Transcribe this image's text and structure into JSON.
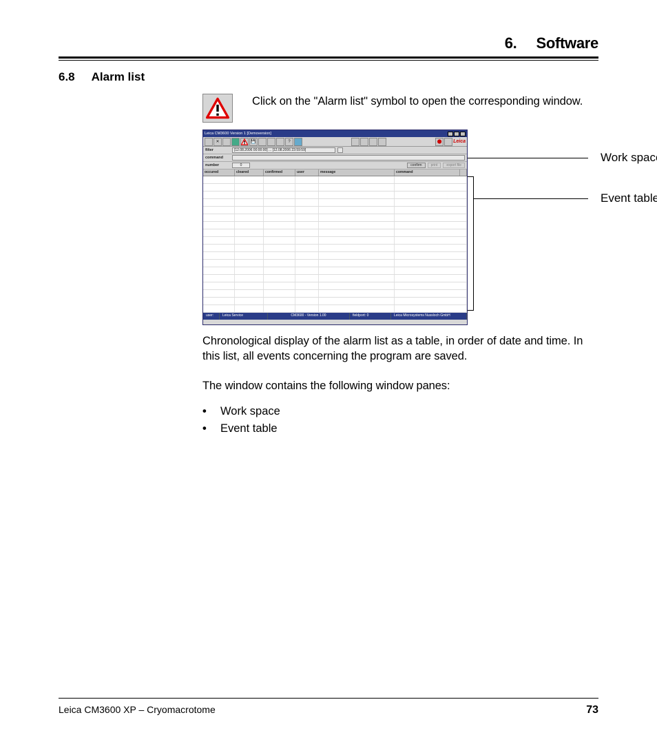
{
  "chapter": {
    "number": "6.",
    "title": "Software"
  },
  "section": {
    "number": "6.8",
    "title": "Alarm list"
  },
  "intro": "Click on the \"Alarm list\" symbol to open the corresponding window.",
  "callouts": {
    "workspace": "Work space",
    "eventtable": "Event table"
  },
  "screenshot": {
    "title": "Leica CM3600 Version 1   [Demoversion]",
    "logo": "Leica",
    "filter_label": "filter",
    "filter_value": "[12.08.2006 00:00:00] ... [12.08.2006 23:59:59]",
    "command_label": "command",
    "number_label": "number",
    "number_value": "0",
    "btn_confirm": "confirm",
    "btn_print": "print",
    "btn_export": "export file",
    "columns": [
      "occured",
      "cleared",
      "confirmed",
      "user",
      "message",
      "command"
    ],
    "status": [
      "user:",
      "Leica Service",
      "CM3600 - Version 1.00",
      "fieldport:  0",
      "Leica Microsystems Nussloch GmbH"
    ]
  },
  "para1": "Chronological display of the alarm list as a table, in order of date and time. In this list, all events concerning the program are saved.",
  "para2": "The window contains the following window panes:",
  "bullets": [
    "Work space",
    "Event table"
  ],
  "footer": {
    "product": "Leica CM3600 XP – Cryomacrotome",
    "page": "73"
  }
}
